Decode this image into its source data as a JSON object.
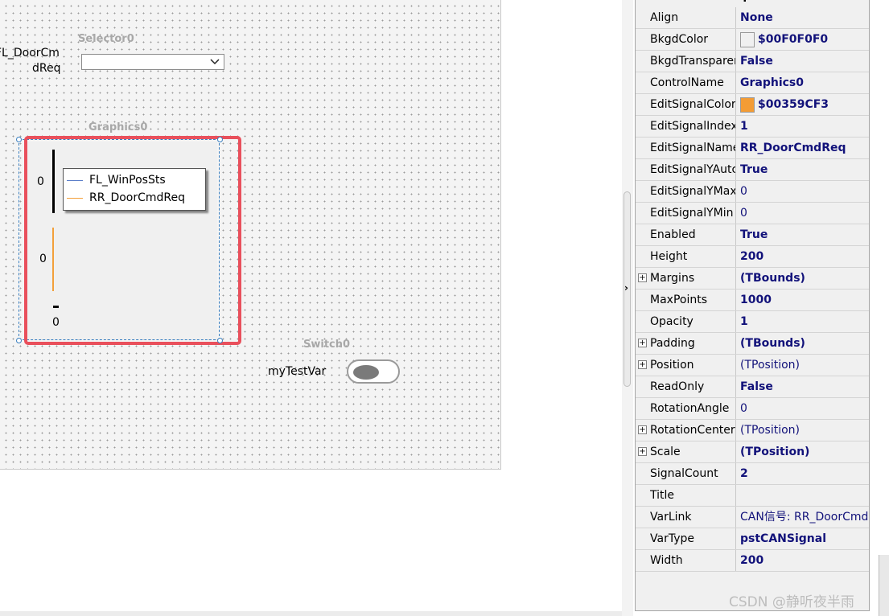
{
  "canvas": {
    "selector": {
      "name": "Selector0",
      "var_label_line1": "FL_DoorCm",
      "var_label_line2": "dReq",
      "value": ""
    },
    "graphics": {
      "name": "Graphics0",
      "ticks": {
        "top": "0",
        "middle": "0",
        "bottom": "0"
      },
      "legend": [
        {
          "name": "FL_WinPosSts",
          "color": "#5b7ec9"
        },
        {
          "name": "RR_DoorCmdReq",
          "color": "#f3a03a"
        }
      ],
      "frame_color": "#e9505c"
    },
    "switch": {
      "name": "Switch0",
      "var_label": "myTestVar",
      "state": "off"
    }
  },
  "inspector": {
    "title": "Graphics0",
    "properties": [
      {
        "name": "Align",
        "value": "None",
        "bold": true,
        "expand": false
      },
      {
        "name": "BkgdColor",
        "value": "$00F0F0F0",
        "bold": true,
        "expand": false,
        "swatch": "#f0f0f0"
      },
      {
        "name": "BkgdTransparer",
        "value": "False",
        "bold": true,
        "expand": false
      },
      {
        "name": "ControlName",
        "value": "Graphics0",
        "bold": true,
        "expand": false
      },
      {
        "name": "EditSignalColor",
        "value": "$00359CF3",
        "bold": true,
        "expand": false,
        "swatch": "#f39c35"
      },
      {
        "name": "EditSignalIndex",
        "value": "1",
        "bold": true,
        "expand": false
      },
      {
        "name": "EditSignalName",
        "value": "RR_DoorCmdReq",
        "bold": true,
        "expand": false
      },
      {
        "name": "EditSignalYAutc",
        "value": "True",
        "bold": true,
        "expand": false
      },
      {
        "name": "EditSignalYMax",
        "value": "0",
        "bold": false,
        "expand": false
      },
      {
        "name": "EditSignalYMin",
        "value": "0",
        "bold": false,
        "expand": false
      },
      {
        "name": "Enabled",
        "value": "True",
        "bold": true,
        "expand": false
      },
      {
        "name": "Height",
        "value": "200",
        "bold": true,
        "expand": false
      },
      {
        "name": "Margins",
        "value": "(TBounds)",
        "bold": true,
        "expand": true
      },
      {
        "name": "MaxPoints",
        "value": "1000",
        "bold": true,
        "expand": false
      },
      {
        "name": "Opacity",
        "value": "1",
        "bold": true,
        "expand": false
      },
      {
        "name": "Padding",
        "value": "(TBounds)",
        "bold": true,
        "expand": true
      },
      {
        "name": "Position",
        "value": "(TPosition)",
        "bold": false,
        "expand": true
      },
      {
        "name": "ReadOnly",
        "value": "False",
        "bold": true,
        "expand": false
      },
      {
        "name": "RotationAngle",
        "value": "0",
        "bold": false,
        "expand": false
      },
      {
        "name": "RotationCenter",
        "value": "(TPosition)",
        "bold": false,
        "expand": true
      },
      {
        "name": "Scale",
        "value": "(TPosition)",
        "bold": true,
        "expand": true
      },
      {
        "name": "SignalCount",
        "value": "2",
        "bold": true,
        "expand": false
      },
      {
        "name": "Title",
        "value": "",
        "bold": false,
        "expand": false
      },
      {
        "name": "VarLink",
        "value": "CAN信号: RR_DoorCmd",
        "bold": false,
        "expand": false
      },
      {
        "name": "VarType",
        "value": "pstCANSignal",
        "bold": true,
        "expand": false
      },
      {
        "name": "Width",
        "value": "200",
        "bold": true,
        "expand": false
      }
    ]
  },
  "watermark": "CSDN @静听夜半雨"
}
